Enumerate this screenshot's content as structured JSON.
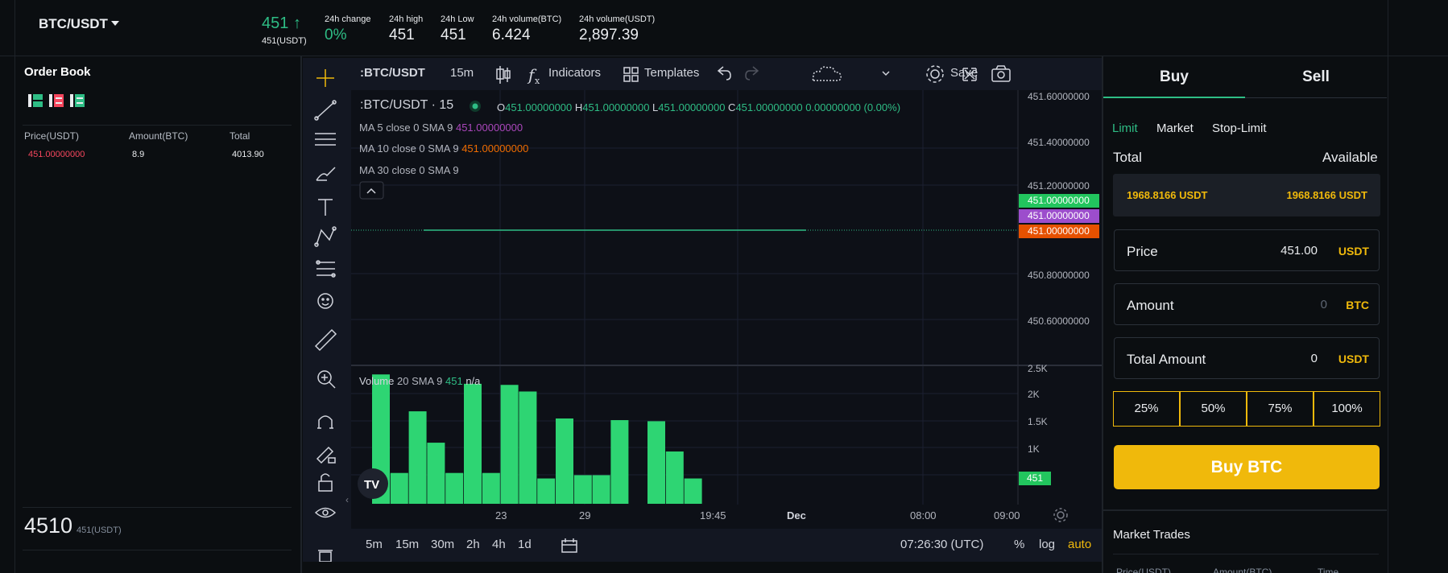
{
  "header": {
    "pair": "BTC/USDT",
    "last_price": "451",
    "price_arrow": "↑",
    "last_price_sub": "451(USDT)",
    "stats": [
      {
        "label": "24h change",
        "value": "0%"
      },
      {
        "label": "24h high",
        "value": "451"
      },
      {
        "label": "24h Low",
        "value": "451"
      },
      {
        "label": "24h volume(BTC)",
        "value": "6.424"
      },
      {
        "label": "24h volume(USDT)",
        "value": "2,897.39"
      }
    ]
  },
  "orderbook": {
    "title": "Order Book",
    "columns": [
      "Price(USDT)",
      "Amount(BTC)",
      "Total"
    ],
    "rows": [
      {
        "price": "451.00000000",
        "amount": "8.9",
        "total": "4013.90"
      }
    ],
    "last_price_big": "4510",
    "last_price_big_sub": "451(USDT)"
  },
  "chart": {
    "symbol": ":BTC/USDT",
    "interval": "15m",
    "indicators_label": "Indicators",
    "templates_label": "Templates",
    "save_label": "Save",
    "legend_title": ":BTC/USDT · 15",
    "ohlc": {
      "o": "451.00000000",
      "h": "451.00000000",
      "l": "451.00000000",
      "c": "451.00000000",
      "change": "0.00000000 (0.00%)"
    },
    "ma": [
      {
        "label": "MA 5 close 0 SMA 9",
        "value": "451.00000000",
        "color": "#ab47bc"
      },
      {
        "label": "MA 10 close 0 SMA 9",
        "value": "451.00000000",
        "color": "#ef6c00"
      },
      {
        "label": "MA 30 close 0 SMA 9",
        "value": "",
        "color": "#d1d4dc"
      }
    ],
    "volume_label": "Volume",
    "volume_sma": "20 SMA 9",
    "volume_val": "451",
    "volume_na": "n/a",
    "price_axis": [
      "451.60000000",
      "451.40000000",
      "451.20000000",
      "451.00000000",
      "451.00000000",
      "451.00000000",
      "450.80000000",
      "450.60000000"
    ],
    "price_tags": [
      {
        "value": "451.00000000",
        "color": "#22c55e"
      },
      {
        "value": "451.00000000",
        "color": "#9c4dcc"
      },
      {
        "value": "451.00000000",
        "color": "#e65100"
      }
    ],
    "vol_axis": [
      "2.5K",
      "2K",
      "1.5K",
      "1K"
    ],
    "vol_tag": "451",
    "time_axis": [
      "23",
      "29",
      "19:45",
      "Dec",
      "08:00",
      "09:00"
    ],
    "timeframes": [
      "5m",
      "15m",
      "30m",
      "2h",
      "4h",
      "1d"
    ],
    "clock": "07:26:30 (UTC)",
    "percent_label": "%",
    "log_label": "log",
    "auto_label": "auto"
  },
  "chart_data": {
    "type": "bar",
    "title": "",
    "ylabel": "Volume",
    "ylim": [
      0,
      2500
    ],
    "values": [
      2350,
      560,
      1680,
      1110,
      560,
      2180,
      560,
      2160,
      2040,
      460,
      1550,
      520,
      520,
      1520,
      0,
      1500,
      950,
      460
    ],
    "color": "#2ed573"
  },
  "trade": {
    "tab_buy": "Buy",
    "tab_sell": "Sell",
    "order_types": [
      "Limit",
      "Market",
      "Stop-Limit"
    ],
    "total_label": "Total",
    "available_label": "Available",
    "total_value": "1968.8166 USDT",
    "available_value": "1968.8166 USDT",
    "price_label": "Price",
    "price_value": "451.00",
    "price_unit": "USDT",
    "amount_label": "Amount",
    "amount_value": "0",
    "amount_unit": "BTC",
    "total_amount_label": "Total Amount",
    "total_amount_value": "0",
    "total_amount_unit": "USDT",
    "percents": [
      "25%",
      "50%",
      "75%",
      "100%"
    ],
    "buy_button": "Buy BTC",
    "market_trades_title": "Market Trades",
    "market_trades_columns": [
      "Price(USDT)",
      "Amount(BTC)",
      "Time"
    ]
  },
  "colors": {
    "up": "#2ebd85",
    "down": "#f6465d",
    "accent": "#f0b90b",
    "bg": "#0b0e11"
  }
}
